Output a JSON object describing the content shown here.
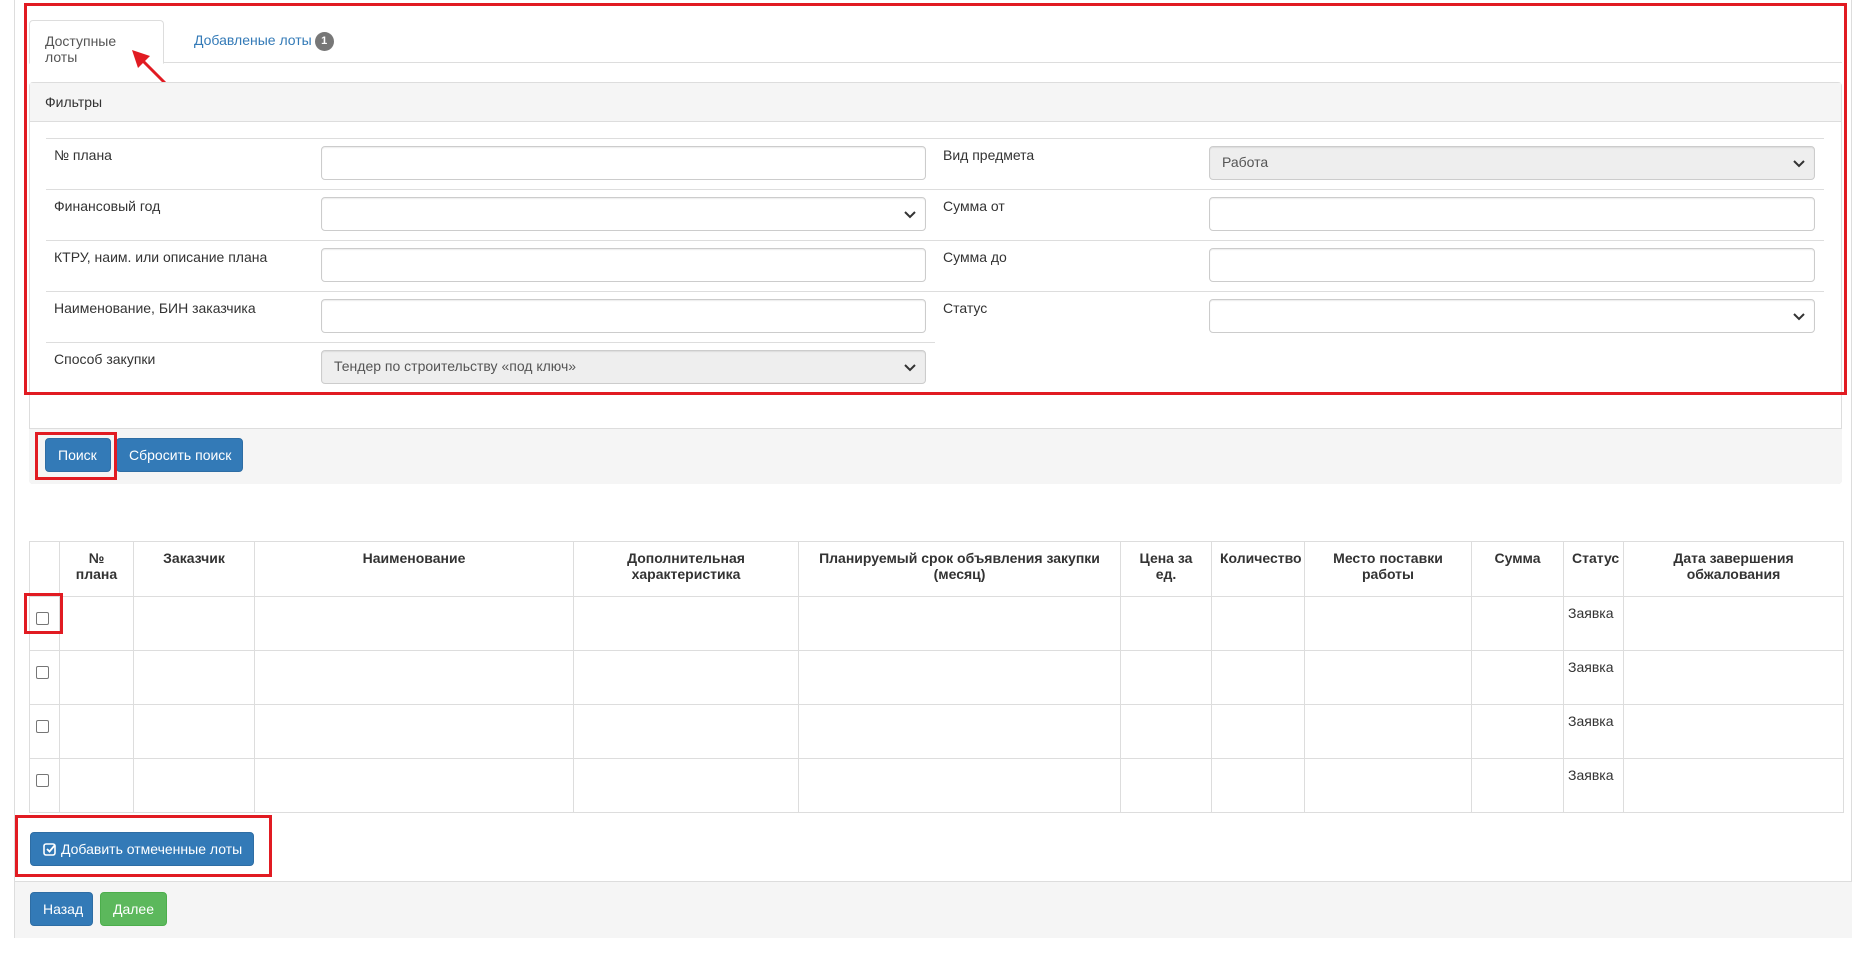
{
  "tabs": {
    "available": "Доступные лоты",
    "added": "Добавленые лоты",
    "added_count": "1"
  },
  "filters": {
    "heading": "Фильтры",
    "plan_no": {
      "label": "№ плана",
      "value": ""
    },
    "fin_year": {
      "label": "Финансовый год",
      "value": ""
    },
    "ktru": {
      "label": "КТРУ, наим. или описание плана",
      "value": ""
    },
    "customer": {
      "label": "Наименование, БИН заказчика",
      "value": ""
    },
    "method": {
      "label": "Способ закупки",
      "value": "Тендер по строительству «под ключ»"
    },
    "subject_type": {
      "label": "Вид предмета",
      "value": "Работа"
    },
    "sum_from": {
      "label": "Сумма от",
      "value": ""
    },
    "sum_to": {
      "label": "Сумма до",
      "value": ""
    },
    "status": {
      "label": "Статус",
      "value": ""
    }
  },
  "buttons": {
    "search": "Поиск",
    "reset": "Сбросить поиск",
    "add_selected": "Добавить отмеченные лоты",
    "back": "Назад",
    "next": "Далее"
  },
  "table": {
    "headers": [
      "№ плана",
      "Заказчик",
      "Наименование",
      "Дополнительная характеристика",
      "Планируемый срок объявления закупки (месяц)",
      "Цена за ед.",
      "Количество",
      "Место поставки работы",
      "Сумма",
      "Статус",
      "Дата завершения обжалования"
    ],
    "rows": [
      {
        "status": "Заявка"
      },
      {
        "status": "Заявка"
      },
      {
        "status": "Заявка"
      },
      {
        "status": "Заявка"
      }
    ]
  },
  "colors": {
    "primary": "#337ab7",
    "success": "#5cb85c",
    "highlight": "#e11b22"
  }
}
